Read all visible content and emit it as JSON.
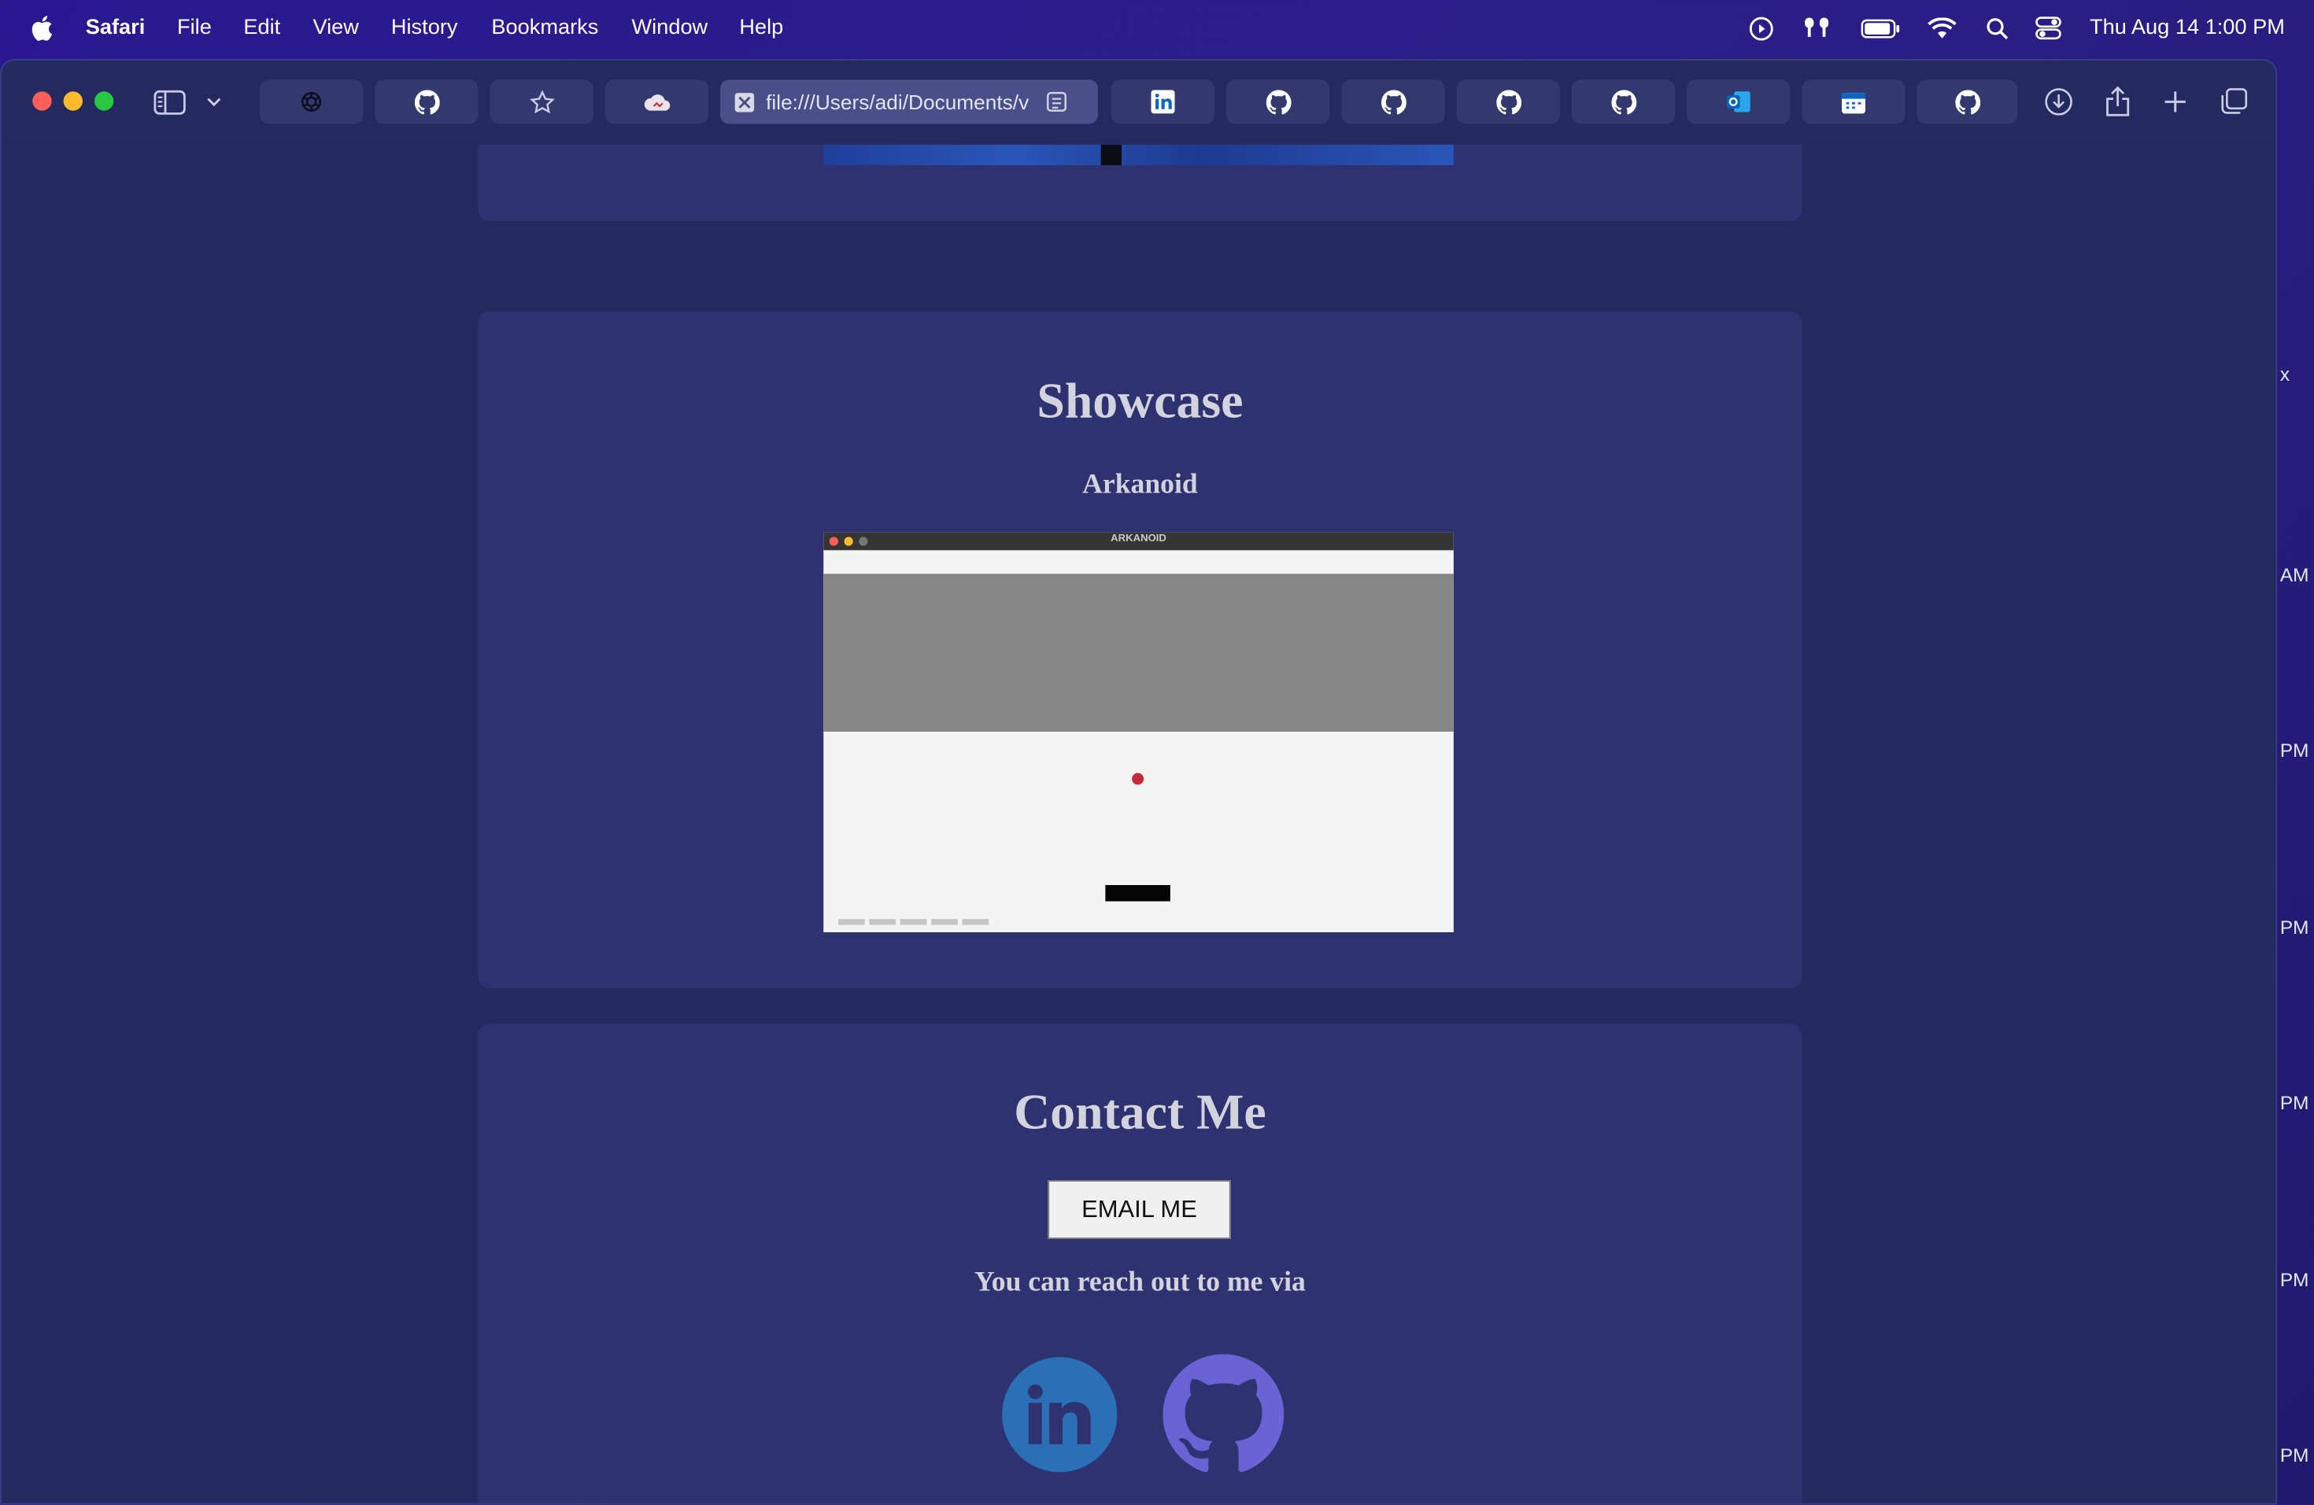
{
  "menubar": {
    "app": "Safari",
    "items": [
      "File",
      "Edit",
      "View",
      "History",
      "Bookmarks",
      "Window",
      "Help"
    ],
    "clock": "Thu Aug 14  1:00 PM"
  },
  "browser": {
    "address": "file:///Users/adi/Documents/v",
    "tabs": [
      "openai-icon",
      "github-icon",
      "star-icon",
      "cloud-icon",
      "address",
      "linkedin-icon",
      "github-icon",
      "github-icon",
      "github-icon",
      "github-icon",
      "outlook-icon",
      "calendar-icon",
      "github-icon"
    ]
  },
  "showcase": {
    "title": "Showcase",
    "project": "Arkanoid",
    "preview_title": "ARKANOID"
  },
  "contact": {
    "title": "Contact Me",
    "button": "EMAIL ME",
    "reach": "You can reach out to me via",
    "links": [
      "linkedin-icon",
      "github-icon"
    ]
  },
  "edge_labels": [
    "x",
    "AM",
    "PM",
    "PM",
    "PM",
    "PM",
    "PM"
  ],
  "colors": {
    "accent_linkedin": "#2b6fb7",
    "accent_github": "#6a63d6",
    "card": "#2f3270"
  }
}
